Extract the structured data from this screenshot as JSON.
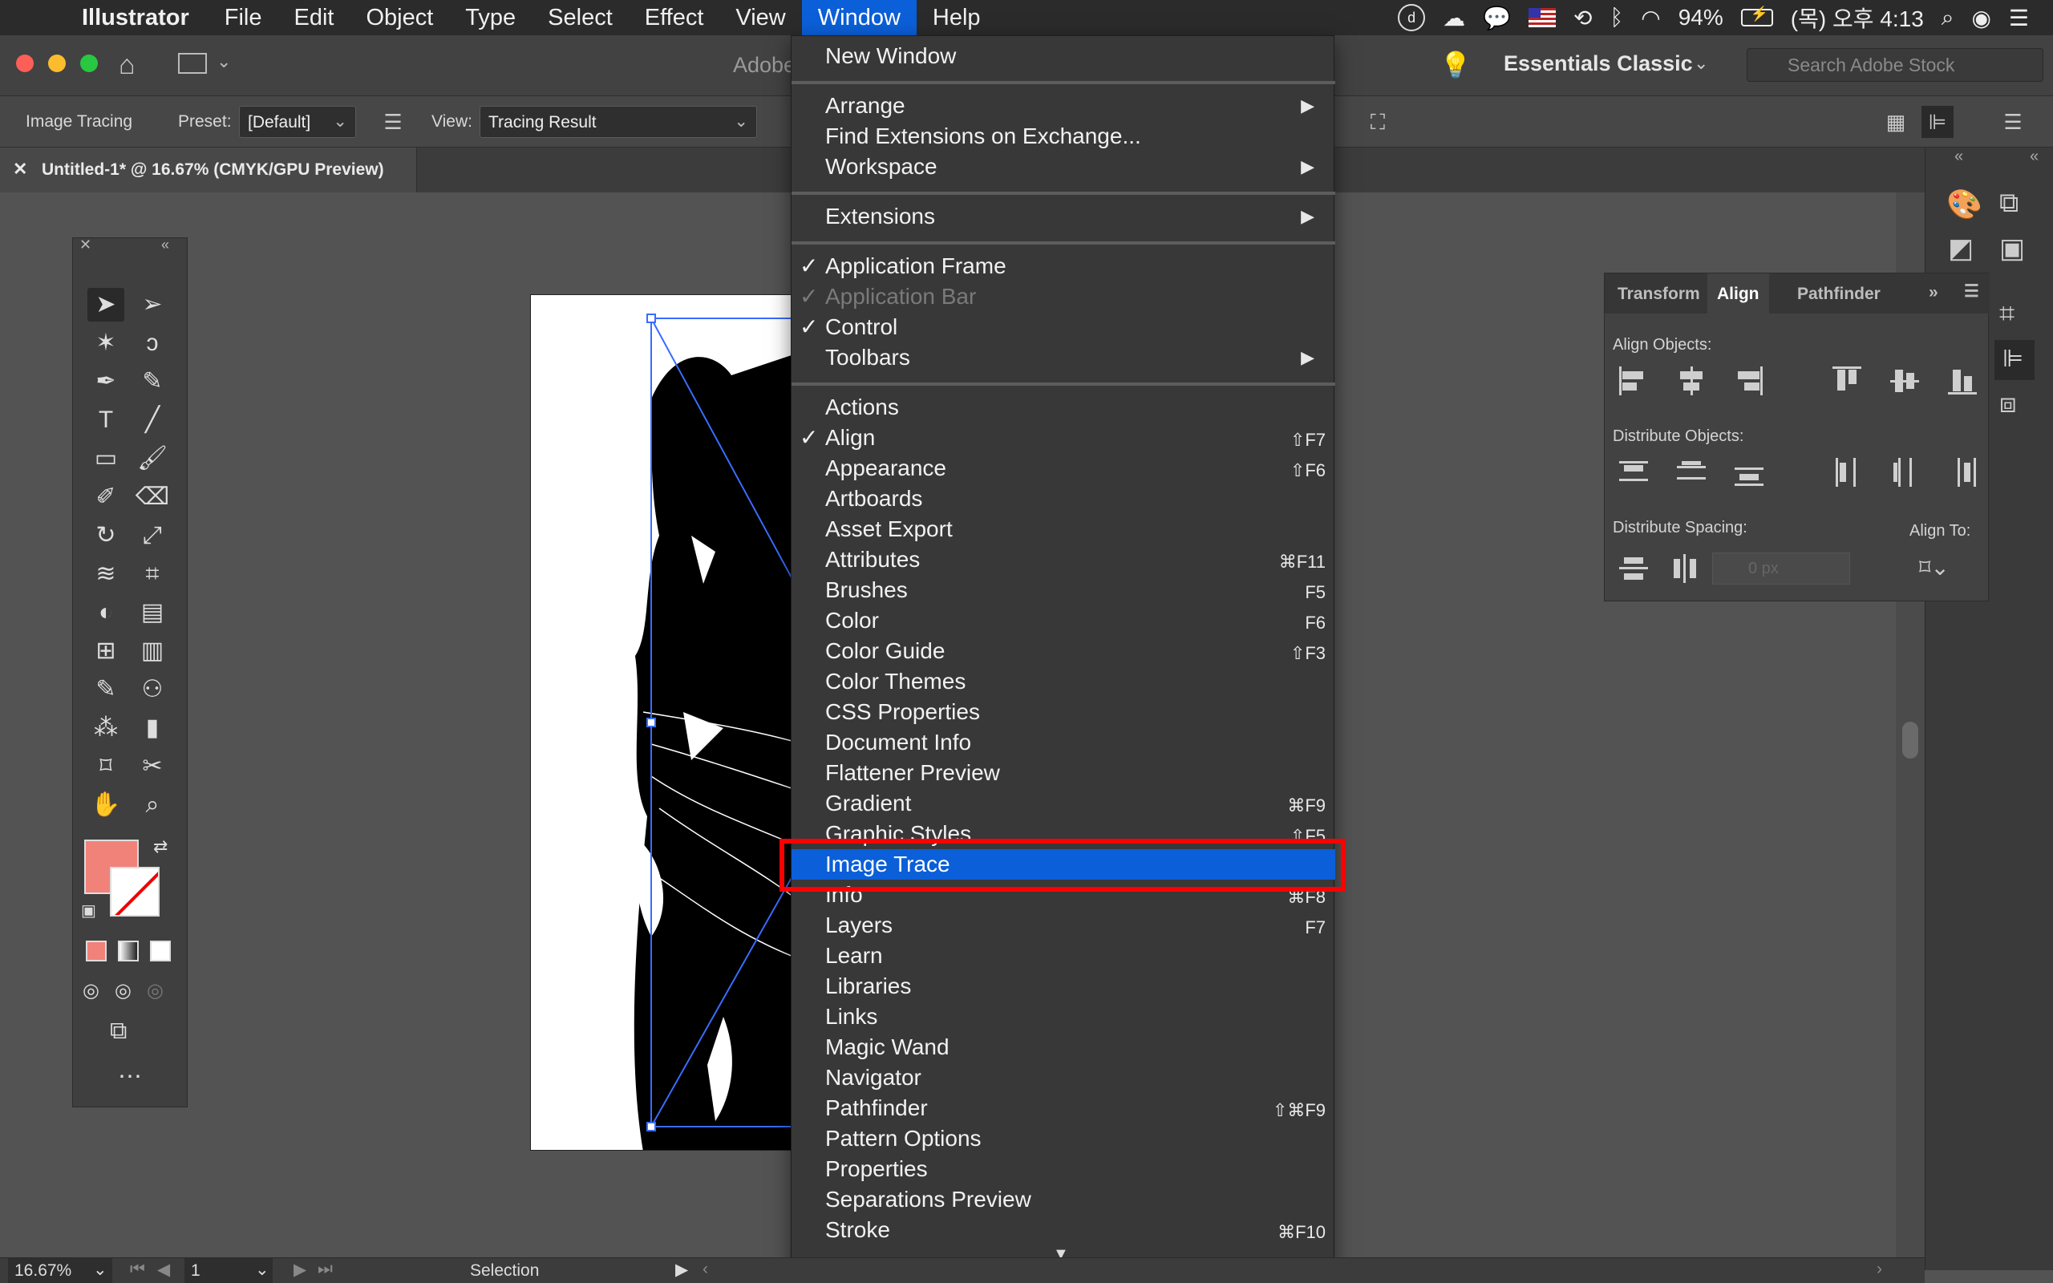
{
  "menubar": {
    "app": "Illustrator",
    "items": [
      "File",
      "Edit",
      "Object",
      "Type",
      "Select",
      "Effect",
      "View",
      "Window",
      "Help"
    ],
    "active": "Window",
    "status": {
      "battery": "94%",
      "clock": "(목) 오후 4:13"
    }
  },
  "appbar": {
    "title_partial": "Adobe",
    "workspace": "Essentials Classic",
    "search_placeholder": "Search Adobe Stock"
  },
  "control": {
    "label": "Image Tracing",
    "preset_label": "Preset:",
    "preset_value": "[Default]",
    "view_label": "View:",
    "view_value": "Tracing Result"
  },
  "doc_tab": {
    "title": "Untitled-1* @ 16.67% (CMYK/GPU Preview)"
  },
  "window_menu": {
    "items": [
      {
        "label": "New Window"
      },
      {
        "label": "Arrange",
        "submenu": true
      },
      {
        "label": "Find Extensions on Exchange..."
      },
      {
        "label": "Workspace",
        "submenu": true
      },
      {
        "label": "Extensions",
        "submenu": true
      },
      {
        "label": "Application Frame",
        "checked": true
      },
      {
        "label": "Application Bar",
        "checked": true,
        "disabled": true
      },
      {
        "label": "Control",
        "checked": true
      },
      {
        "label": "Toolbars",
        "submenu": true
      },
      {
        "label": "Actions"
      },
      {
        "label": "Align",
        "checked": true,
        "shortcut": "⇧F7"
      },
      {
        "label": "Appearance",
        "shortcut": "⇧F6"
      },
      {
        "label": "Artboards"
      },
      {
        "label": "Asset Export"
      },
      {
        "label": "Attributes",
        "shortcut": "⌘F11"
      },
      {
        "label": "Brushes",
        "shortcut": "F5"
      },
      {
        "label": "Color",
        "shortcut": "F6"
      },
      {
        "label": "Color Guide",
        "shortcut": "⇧F3"
      },
      {
        "label": "Color Themes"
      },
      {
        "label": "CSS Properties"
      },
      {
        "label": "Document Info"
      },
      {
        "label": "Flattener Preview"
      },
      {
        "label": "Gradient",
        "shortcut": "⌘F9"
      },
      {
        "label": "Graphic Styles",
        "shortcut": "⇧F5"
      },
      {
        "label": "Image Trace",
        "highlighted": true
      },
      {
        "label": "Info",
        "shortcut": "⌘F8"
      },
      {
        "label": "Layers",
        "shortcut": "F7"
      },
      {
        "label": "Learn"
      },
      {
        "label": "Libraries"
      },
      {
        "label": "Links"
      },
      {
        "label": "Magic Wand"
      },
      {
        "label": "Navigator"
      },
      {
        "label": "Pathfinder",
        "shortcut": "⇧⌘F9"
      },
      {
        "label": "Pattern Options"
      },
      {
        "label": "Properties"
      },
      {
        "label": "Separations Preview"
      },
      {
        "label": "Stroke",
        "shortcut": "⌘F10"
      }
    ],
    "more_arrow": "▼"
  },
  "align_panel": {
    "tabs": [
      "Transform",
      "Align",
      "Pathfinder"
    ],
    "active_tab": "Align",
    "align_objects": "Align Objects:",
    "distribute_objects": "Distribute Objects:",
    "distribute_spacing": "Distribute Spacing:",
    "align_to": "Align To:",
    "spacing_value": "0 px"
  },
  "statusbar": {
    "zoom": "16.67%",
    "artboard": "1",
    "tool": "Selection"
  },
  "colors": {
    "menu_highlight": "#0b5fd8",
    "callout": "#ff0000",
    "fill_swatch": "#f0827a"
  }
}
